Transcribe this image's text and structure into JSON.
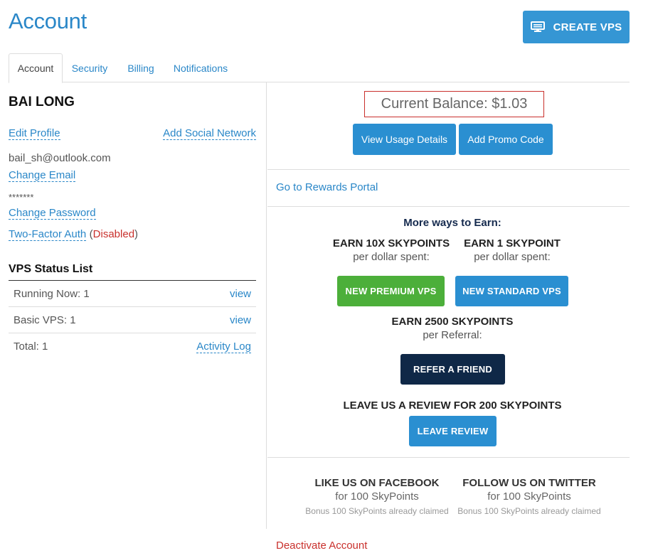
{
  "header": {
    "title": "Account",
    "create_vps_label": "CREATE VPS"
  },
  "tabs": [
    {
      "label": "Account",
      "active": true
    },
    {
      "label": "Security",
      "active": false
    },
    {
      "label": "Billing",
      "active": false
    },
    {
      "label": "Notifications",
      "active": false
    }
  ],
  "profile": {
    "name": "BAI LONG",
    "edit_profile": "Edit Profile",
    "add_social": "Add Social Network",
    "email": "bail_sh@outlook.com",
    "change_email": "Change Email",
    "password_mask": "*******",
    "change_password": "Change Password",
    "two_factor": "Two-Factor Auth",
    "two_factor_open": "(",
    "two_factor_status": "Disabled",
    "two_factor_close": ")"
  },
  "vps_status": {
    "title": "VPS Status List",
    "rows": [
      {
        "label": "Running Now: 1",
        "action": "view"
      },
      {
        "label": "Basic VPS: 1",
        "action": "view"
      },
      {
        "label": "Total: 1",
        "action": "Activity Log"
      }
    ]
  },
  "balance": {
    "text": "Current Balance: $1.03",
    "view_usage": "View Usage Details",
    "add_promo": "Add Promo Code"
  },
  "rewards": {
    "portal_link": "Go to Rewards Portal",
    "more_ways": "More ways to Earn:",
    "premium_head": "EARN 10X SKYPOINTS",
    "premium_sub": "per dollar spent:",
    "standard_head": "EARN 1 SKYPOINT",
    "standard_sub": "per dollar spent:",
    "premium_button": "NEW PREMIUM VPS",
    "standard_button": "NEW STANDARD VPS",
    "referral_head": "EARN 2500 SKYPOINTS",
    "referral_sub": "per Referral:",
    "refer_button": "REFER A FRIEND",
    "review_head": "LEAVE US A REVIEW FOR 200 SKYPOINTS",
    "review_button": "LEAVE REVIEW"
  },
  "social": {
    "facebook_head": "LIKE US ON FACEBOOK",
    "facebook_sub": "for 100 SkyPoints",
    "facebook_note": "Bonus 100 SkyPoints already claimed",
    "twitter_head": "FOLLOW US ON TWITTER",
    "twitter_sub": "for 100 SkyPoints",
    "twitter_note": "Bonus 100 SkyPoints already claimed"
  },
  "footer": {
    "deactivate": "Deactivate Account"
  },
  "colors": {
    "accent_blue": "#2a87c8",
    "button_blue": "#2a8fd1",
    "green": "#4caf3a",
    "navy": "#0f2847",
    "danger": "#c9302c"
  },
  "icons": {
    "create_vps": "monitor-icon"
  }
}
